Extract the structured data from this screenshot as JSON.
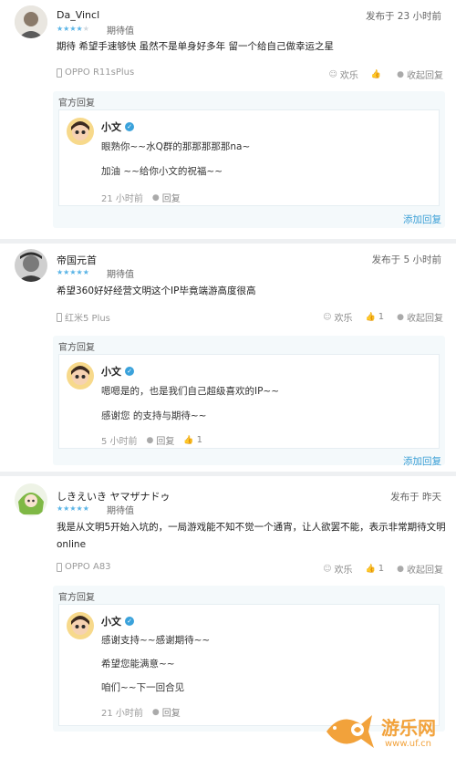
{
  "reviews": [
    {
      "username": "Da_Vincl",
      "rating": 4,
      "rating_label": "期待值",
      "time": "发布于 23 小时前",
      "content": "期待 希望手速够快 虽然不是单身好多年 留一个给自己做幸运之星",
      "device": "OPPO R11sPlus",
      "actions": {
        "happy": "欢乐",
        "like": "",
        "collapse": "收起回复"
      },
      "official": {
        "title": "官方回复",
        "name": "小文",
        "lines": [
          "眼熟你~~水Q群的那那那那那na~",
          "加油 ~~给你小文的祝福~~"
        ],
        "time": "21 小时前",
        "reply": "回复",
        "likes": ""
      },
      "add_reply": "添加回复"
    },
    {
      "username": "帝国元首",
      "rating": 5,
      "rating_label": "期待值",
      "time": "发布于 5 小时前",
      "content": "希望360好好经营文明这个IP毕竟端游高度很高",
      "device": "红米5 Plus",
      "actions": {
        "happy": "欢乐",
        "like": "1",
        "collapse": "收起回复"
      },
      "official": {
        "title": "官方回复",
        "name": "小文",
        "lines": [
          "嗯嗯是的，也是我们自己超级喜欢的IP~~",
          "感谢您 的支持与期待~~"
        ],
        "time": "5 小时前",
        "reply": "回复",
        "likes": "1"
      },
      "add_reply": "添加回复"
    },
    {
      "username": "しきえいき ヤマザナドゥ",
      "rating": 5,
      "rating_label": "期待值",
      "time": "发布于 昨天",
      "content": "我是从文明5开始入坑的，一局游戏能不知不觉一个通宵，让人欲罢不能，表示非常期待文明online",
      "device": "OPPO A83",
      "actions": {
        "happy": "欢乐",
        "like": "1",
        "collapse": "收起回复"
      },
      "official": {
        "title": "官方回复",
        "name": "小文",
        "lines": [
          "感谢支持~~感谢期待~~",
          "希望您能满意~~",
          "咱们~~下一回合见"
        ],
        "time": "21 小时前",
        "reply": "回复",
        "likes": ""
      }
    }
  ],
  "watermark": {
    "name": "游乐网",
    "url": "www.uf.cn"
  },
  "colors": {
    "accent": "#3a9fd6",
    "star": "#5ab4e6",
    "official_bg": "#f4f9fb",
    "watermark": "#f2a23b"
  }
}
